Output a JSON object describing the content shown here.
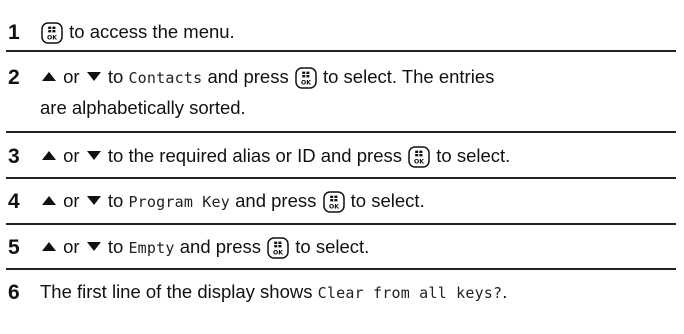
{
  "steps": [
    {
      "number": "1",
      "suffix": " to access the menu."
    },
    {
      "number": "2",
      "or": " or ",
      "to": " to ",
      "target": "Contacts",
      "and_press": " and press ",
      "after_line1": " to select. The entries",
      "line2": "are alphabetically sorted."
    },
    {
      "number": "3",
      "or": " or ",
      "middle": " to the required alias or ID and press ",
      "after": " to select."
    },
    {
      "number": "4",
      "or": " or ",
      "to": " to ",
      "target": "Program Key",
      "and_press": " and press ",
      "after": " to select."
    },
    {
      "number": "5",
      "or": " or ",
      "to": " to ",
      "target": "Empty",
      "and_press": " and press ",
      "after": " to select."
    },
    {
      "number": "6",
      "prefix": "The first line of the display shows ",
      "display_text": "Clear from all keys?",
      "end": "."
    }
  ],
  "icons": {
    "menu_ok_key": "menu-ok-key-icon",
    "up_arrow": "up-arrow-icon",
    "down_arrow": "down-arrow-icon"
  },
  "colors": {
    "text": "#111111",
    "rule": "#222222"
  }
}
